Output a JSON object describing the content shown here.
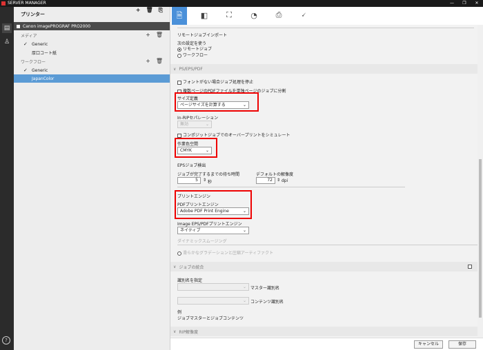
{
  "window": {
    "title": "SERVER MANAGER",
    "minimize": "—",
    "restore": "❐",
    "close": "✕"
  },
  "rail": {
    "printer_icon": "▤",
    "user_icon": "♙",
    "help": "?"
  },
  "left": {
    "header": "プリンター",
    "printer_name": "Canon imagePROGRAF PRO2000",
    "media_label": "メディア",
    "media_items": [
      {
        "check": "✓",
        "label": "Generic"
      },
      {
        "check": "",
        "label": "厚口コート紙"
      }
    ],
    "workflow_label": "ワークフロー",
    "workflow_items": [
      {
        "check": "✓",
        "label": "Generic"
      },
      {
        "check": "",
        "label": "JapanColor"
      }
    ],
    "add": "+",
    "del": "🗑",
    "import": "⎘"
  },
  "tabs": [
    "🗎",
    "◧",
    "⛶",
    "◔",
    "⎙",
    "🗸"
  ],
  "remote": {
    "title": "リモートジョブインポート",
    "next_label": "次の設定を使う",
    "opt1": "リモートジョブ",
    "opt2": "ワークフロー"
  },
  "ps": {
    "head": "PS/EPS/PDF",
    "fontstop": "フォントがない場合ジョブ処理を停止",
    "splitpdf": "複数ページのPDFファイルを単独ページのジョブに分割",
    "size_label": "サイズ定義",
    "size_value": "ページサイズを計算する",
    "inrip_label": "In-RIPセパレーション",
    "inrip_value": "無効",
    "overprint": "コンポジットジョブでのオーバープリントをシミュレート",
    "workspace_label": "作業色空間",
    "workspace_value": "CMYK",
    "eps_label": "EPSジョブ検出",
    "wait_label": "ジョブが完了するまでの待ち時間",
    "wait_value": "5",
    "wait_unit": "秒",
    "res_label": "デフォルトの解像度",
    "res_value": "72",
    "res_unit": "dpi",
    "engine_title": "プリントエンジン",
    "pdf_engine_label": "PDFプリントエンジン",
    "pdf_engine_value": "Adobe PDF Print Engine",
    "img_engine_label": "Image EPS/PDFプリントエンジン",
    "img_engine_value": "ネイティブ",
    "smoothing": "ダイナミックスムージング",
    "artifact": "滑らかなグラデーションと圧縮アーティファクト"
  },
  "merge": {
    "head": "ジョブの統合",
    "specify": "識別名を指定",
    "master": "マスター識別名",
    "content": "コンテンツ識別名",
    "example_label": "例",
    "example_value": "ジョブマスターとジョブコンテンツ"
  },
  "rip": {
    "head": "RIP解像度"
  },
  "buttons": {
    "cancel": "キャンセル",
    "save": "保存"
  }
}
